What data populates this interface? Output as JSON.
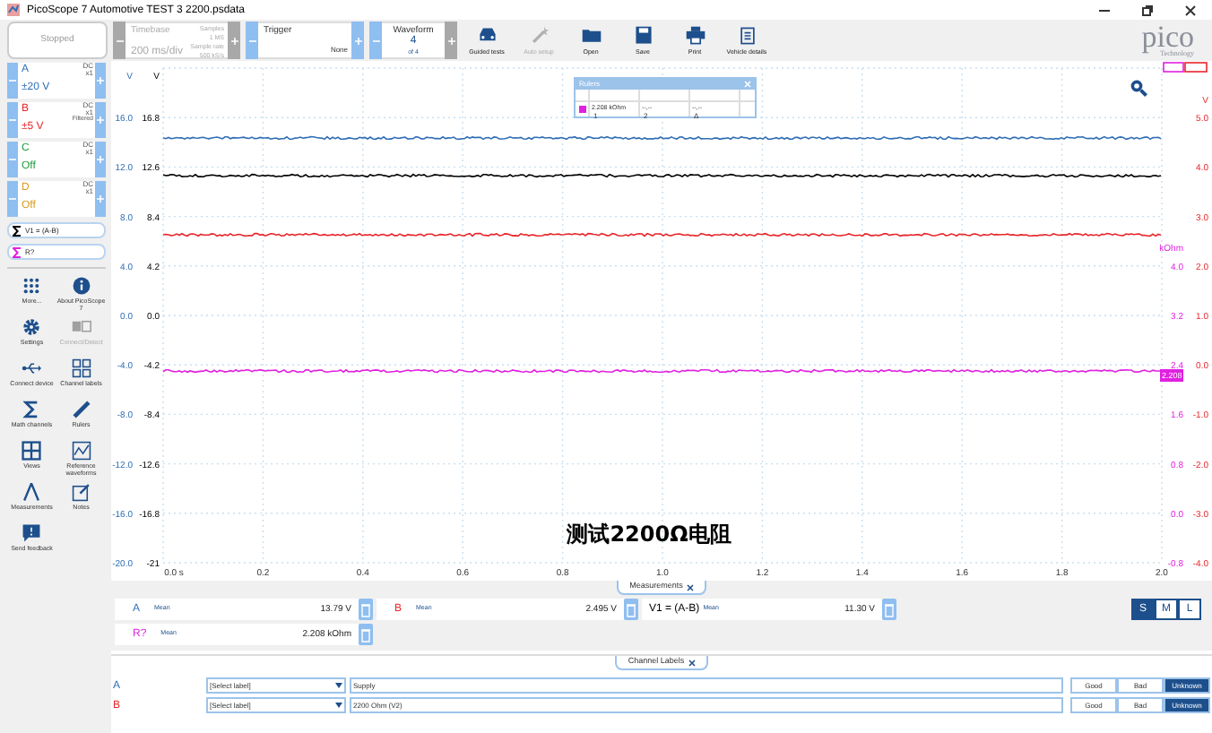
{
  "window": {
    "title": "PicoScope 7 Automotive TEST 3 2200.psdata"
  },
  "toolbar": {
    "run_state": "Stopped",
    "timebase": {
      "label": "Timebase",
      "value": "200 ms/div",
      "samples_label": "Samples",
      "samples": "1 MS",
      "rate_label": "Sample rate",
      "rate": "500 kS/s",
      "enabled": false
    },
    "trigger": {
      "label": "Trigger",
      "mode": "None"
    },
    "waveform": {
      "label": "Waveform",
      "value": "4",
      "of": "of 4"
    },
    "tools": [
      {
        "kind": "car",
        "label": "Guided tests",
        "disabled": false
      },
      {
        "kind": "wand",
        "label": "Auto setup",
        "disabled": true
      },
      {
        "kind": "folder",
        "label": "Open",
        "disabled": false
      },
      {
        "kind": "save",
        "label": "Save",
        "disabled": false
      },
      {
        "kind": "print",
        "label": "Print",
        "disabled": false
      },
      {
        "kind": "clipboard",
        "label": "Vehicle details",
        "disabled": false
      }
    ],
    "logo": {
      "name": "pico",
      "tagline": "Technology"
    }
  },
  "channels": [
    {
      "name": "A",
      "coupling": "DC",
      "probe": "x1",
      "range": "±20 V",
      "color": "#2f6db5"
    },
    {
      "name": "B",
      "coupling": "DC",
      "probe": "x1",
      "note": "Filtered",
      "range": "±5 V",
      "color": "#e8262b"
    },
    {
      "name": "C",
      "coupling": "DC",
      "probe": "x1",
      "range": "Off",
      "color": "#1a9a3a"
    },
    {
      "name": "D",
      "coupling": "DC",
      "probe": "x1",
      "range": "Off",
      "color": "#d99a1c"
    }
  ],
  "math_channels": [
    {
      "label": "V1 = (A-B)",
      "color": "#000000"
    },
    {
      "label": "R?",
      "color": "#e020e0"
    }
  ],
  "side_tools": [
    {
      "kind": "grid",
      "label": "More...",
      "disabled": false
    },
    {
      "kind": "info",
      "label": "About PicoScope 7",
      "disabled": false
    },
    {
      "kind": "gear",
      "label": "Settings",
      "disabled": false
    },
    {
      "kind": "ab",
      "label": "Connect/Detect",
      "disabled": true
    },
    {
      "kind": "usb",
      "label": "Connect device",
      "disabled": false
    },
    {
      "kind": "abcd",
      "label": "Channel labels",
      "disabled": false
    },
    {
      "kind": "sigma",
      "label": "Math channels",
      "disabled": false
    },
    {
      "kind": "ruler",
      "label": "Rulers",
      "disabled": false
    },
    {
      "kind": "views",
      "label": "Views",
      "disabled": false
    },
    {
      "kind": "refwave",
      "label": "Reference waveforms",
      "disabled": false
    },
    {
      "kind": "measure",
      "label": "Measurements",
      "disabled": false
    },
    {
      "kind": "notes",
      "label": "Notes",
      "disabled": false
    },
    {
      "kind": "feedback",
      "label": "Send feedback",
      "disabled": false
    }
  ],
  "scope": {
    "x_ticks": [
      "0.0 s",
      "0.2",
      "0.4",
      "0.6",
      "0.8",
      "1.0",
      "1.2",
      "1.4",
      "1.6",
      "1.8",
      "2.0"
    ],
    "traces": [
      {
        "color": "#2f6db5",
        "axis": {
          "kind": "left",
          "unit": "V",
          "ticks": [
            "16.0",
            "12.0",
            "8.0",
            "4.0",
            "0.0",
            "-4.0",
            "-8.0",
            "-12.0",
            "-16.0",
            "-20.0"
          ]
        }
      },
      {
        "color": "#000000",
        "axis": {
          "kind": "left",
          "unit": "V",
          "ticks": [
            "16.8",
            "12.6",
            "8.4",
            "4.2",
            "0.0",
            "-4.2",
            "-8.4",
            "-12.6",
            "-16.8",
            "-21"
          ]
        }
      },
      {
        "color": "#e020e0",
        "axis": {
          "kind": "right",
          "unit": "kOhm",
          "ticks": [
            "4.0",
            "3.2",
            "2.4",
            "1.6",
            "0.8",
            "0.0",
            "-0.8"
          ]
        }
      },
      {
        "color": "#e8262b",
        "axis": {
          "kind": "right",
          "unit": "V",
          "ticks": [
            "5.0",
            "4.0",
            "3.0",
            "2.0",
            "1.0",
            "0.0",
            "-1.0",
            "-2.0",
            "-3.0",
            "-4.0"
          ]
        }
      }
    ],
    "ruler_marker": {
      "label": "2.208",
      "color": "#e020e0"
    },
    "rulers_panel": {
      "title": "Rulers",
      "columns": [
        "1",
        "2",
        "Δ"
      ],
      "rows": [
        {
          "color": "#e020e0",
          "values": [
            "2.208 kOhm",
            "--,--",
            "--,--"
          ]
        }
      ]
    },
    "caption": "测试2200Ω电阻"
  },
  "measurements": {
    "tab": "Measurements",
    "items": [
      {
        "channel": "A",
        "color": "#2f6db5",
        "stat": "Mean",
        "value": "13.79 V"
      },
      {
        "channel": "B",
        "color": "#e8262b",
        "stat": "Mean",
        "value": "2.495 V"
      },
      {
        "channel": "V1 = (A-B)",
        "color": "#000000",
        "stat": "Mean",
        "value": "11.30 V"
      },
      {
        "channel": "R?",
        "color": "#e020e0",
        "stat": "Mean",
        "value": "2.208 kOhm"
      }
    ],
    "sizes": [
      {
        "label": "S",
        "selected": true
      },
      {
        "label": "M",
        "selected": false
      },
      {
        "label": "L",
        "selected": false
      }
    ]
  },
  "channel_labels": {
    "tab": "Channel Labels",
    "rows": [
      {
        "channel": "A",
        "color": "#2f6db5",
        "select": "[Select label]",
        "text": "Supply",
        "buttons": [
          {
            "label": "Good",
            "selected": false
          },
          {
            "label": "Bad",
            "selected": false
          },
          {
            "label": "Unknown",
            "selected": true
          }
        ]
      },
      {
        "channel": "B",
        "color": "#e8262b",
        "select": "[Select label]",
        "text": "2200 Ohm (V2)",
        "buttons": [
          {
            "label": "Good",
            "selected": false
          },
          {
            "label": "Bad",
            "selected": false
          },
          {
            "label": "Unknown",
            "selected": true
          }
        ]
      }
    ]
  }
}
